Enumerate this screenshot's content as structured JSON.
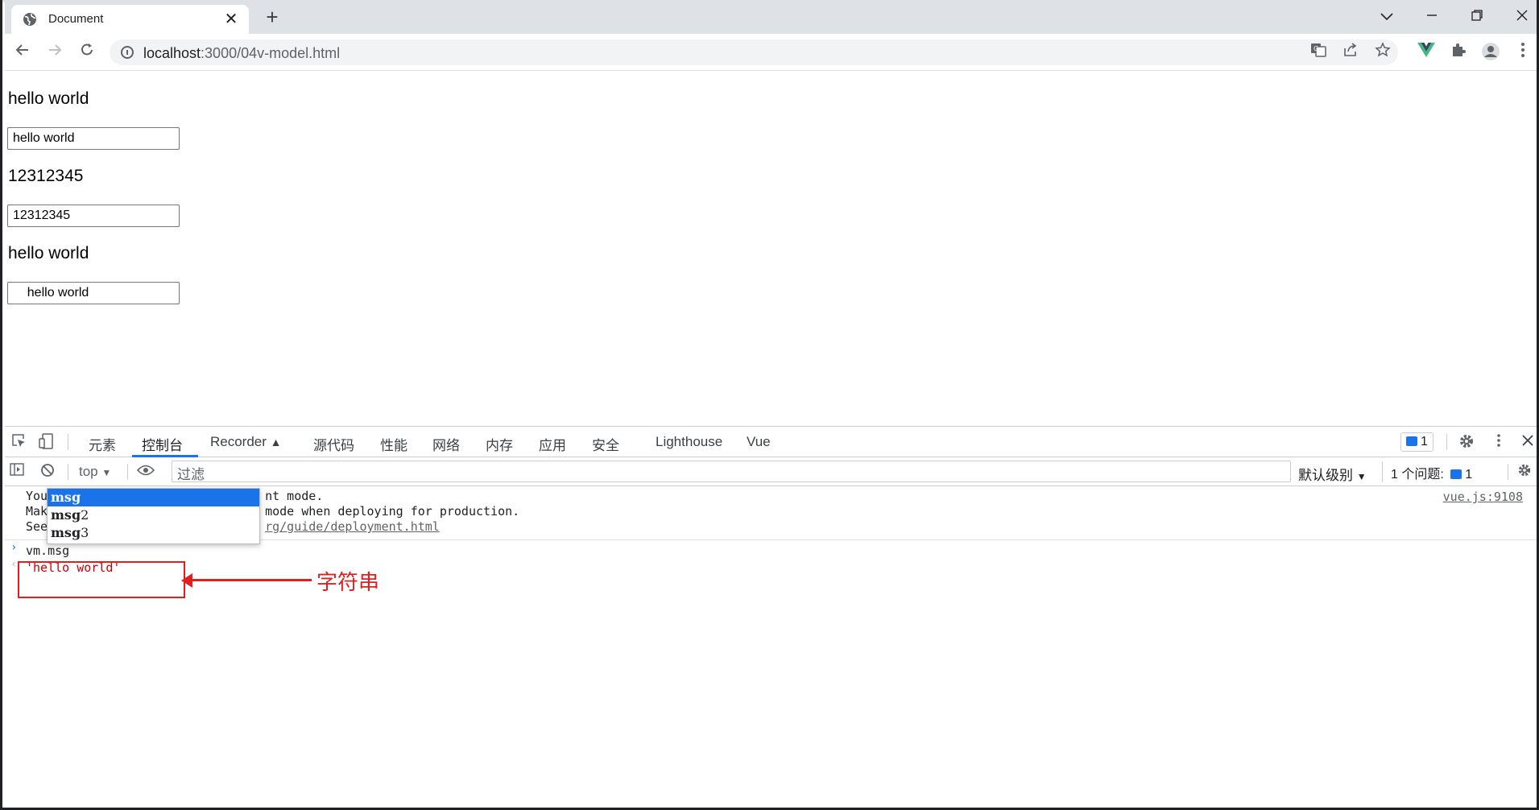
{
  "browser": {
    "tab_title": "Document",
    "tab_close": "✕",
    "new_tab": "+",
    "url_host": "localhost",
    "url_path": ":3000/04v-model.html"
  },
  "page": {
    "text1": "hello world",
    "input1_value": "hello world",
    "text2": "12312345",
    "input2_value": "12312345",
    "text3": "hello world",
    "input3_value": "    hello world"
  },
  "devtools": {
    "tabs": [
      "元素",
      "控制台",
      "Recorder",
      "源代码",
      "性能",
      "网络",
      "内存",
      "应用",
      "安全",
      "Lighthouse",
      "Vue"
    ],
    "message_count": "1",
    "context": "top",
    "filter_placeholder": "过滤",
    "levels": "默认级别",
    "issues_label": "1 个问题:",
    "issues_count": "1"
  },
  "console": {
    "line1_prefix": "You",
    "line1_suffix": "nt mode.",
    "line2_prefix": "Mak",
    "line2_suffix": "mode when deploying for production.",
    "line3_prefix": "See",
    "line3_link": "rg/guide/deployment.html",
    "source_link": "vue.js:9108",
    "input": "vm.msg",
    "result": "'hello world'"
  },
  "autocomplete": {
    "items": [
      {
        "typed": "msg",
        "rest": ""
      },
      {
        "typed": "msg",
        "rest": "2"
      },
      {
        "typed": "msg",
        "rest": "3"
      }
    ]
  },
  "annotation": {
    "label": "字符串",
    "color": "#e02020"
  }
}
